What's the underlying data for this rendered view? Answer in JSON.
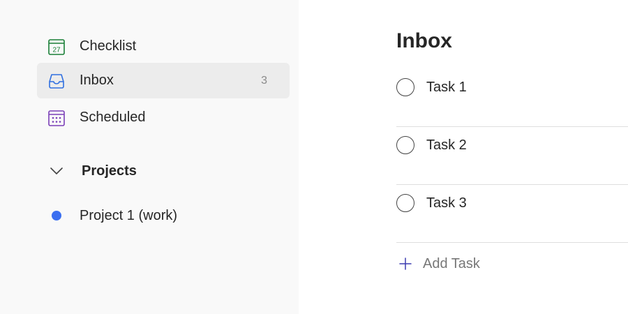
{
  "sidebar": {
    "items": [
      {
        "label": "Checklist",
        "icon": "calendar-27-icon",
        "icon_text": "27",
        "color": "#1a7f37"
      },
      {
        "label": "Inbox",
        "icon": "inbox-tray-icon",
        "count": "3",
        "color": "#2f6fe0",
        "active": true
      },
      {
        "label": "Scheduled",
        "icon": "calendar-grid-icon",
        "color": "#7b3fb8"
      }
    ],
    "projects_header": {
      "label": "Projects",
      "icon": "chevron-down-icon"
    },
    "projects": [
      {
        "label": "Project 1 (work)",
        "color": "#3b6ff0"
      }
    ]
  },
  "main": {
    "title": "Inbox",
    "tasks": [
      {
        "label": "Task 1"
      },
      {
        "label": "Task 2"
      },
      {
        "label": "Task 3"
      }
    ],
    "add_task_label": "Add Task",
    "accent": "#3b3bb0"
  }
}
